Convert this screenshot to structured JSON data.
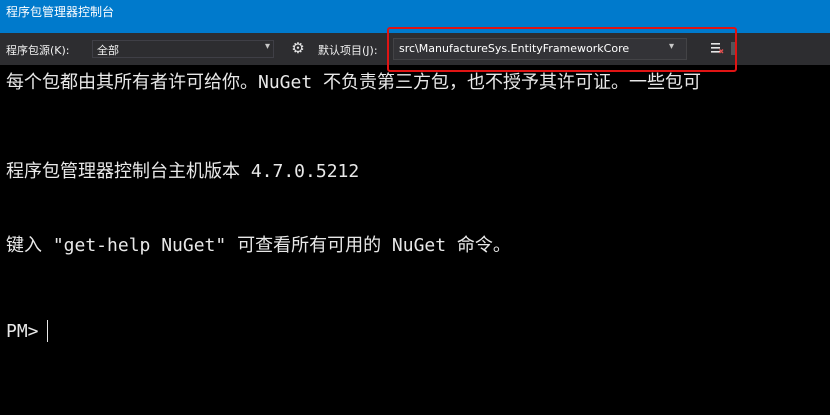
{
  "window": {
    "title": "程序包管理器控制台"
  },
  "toolbar": {
    "source_label": "程序包源(K):",
    "source_value": "全部",
    "default_project_label": "默认项目(J):",
    "default_project_value": "src\\ManufactureSys.EntityFrameworkCore",
    "settings_icon": "gear-icon",
    "clear_icon": "clear-console-icon"
  },
  "console": {
    "lines": [
      "每个包都由其所有者许可给你。NuGet 不负责第三方包，也不授予其许可证。一些包可",
      "程序包管理器控制台主机版本 4.7.0.5212",
      "键入 \"get-help NuGet\" 可查看所有可用的 NuGet 命令。"
    ],
    "prompt": "PM>"
  },
  "colors": {
    "title_bar": "#007acc",
    "toolbar": "#2d2d30",
    "console_bg": "#000000",
    "console_text": "#e8e8e8",
    "highlight_border": "#e01414"
  }
}
